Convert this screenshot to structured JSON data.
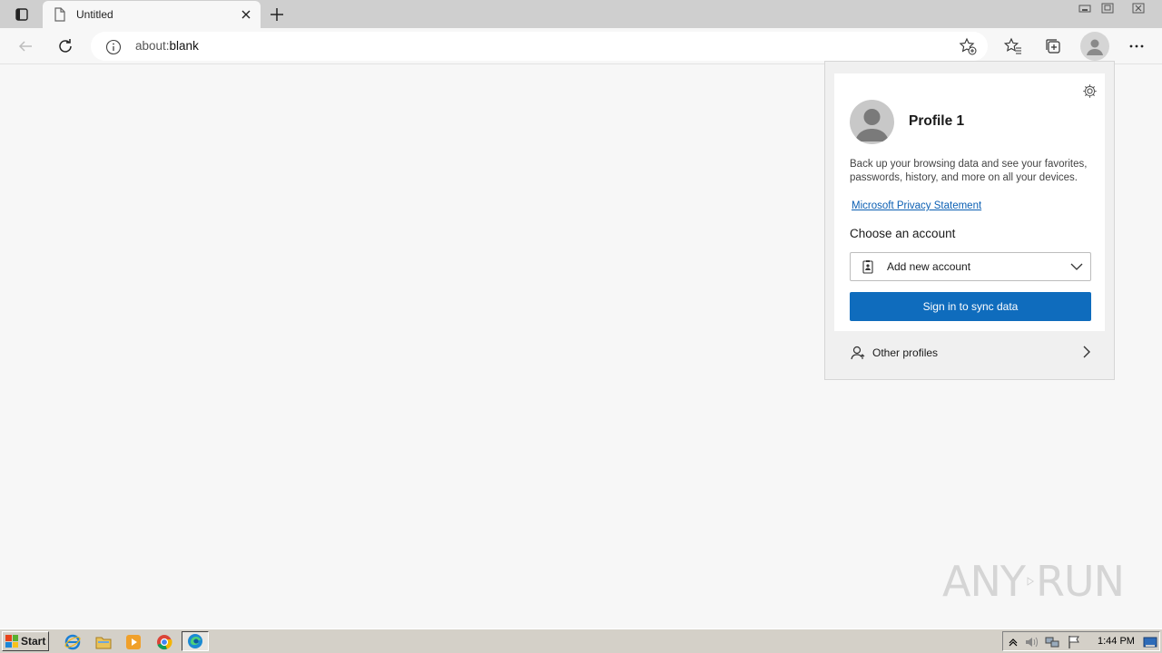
{
  "browser": {
    "tab": {
      "title": "Untitled",
      "icons": [
        "page-icon",
        "close-icon"
      ]
    },
    "address": {
      "prefix": "about:",
      "host": "blank"
    },
    "toolbar_icons": [
      "back-arrow-icon",
      "refresh-icon",
      "info-icon",
      "add-favorite-icon",
      "favorites-icon",
      "collections-icon",
      "profile-icon",
      "more-icon"
    ]
  },
  "profile_flyout": {
    "name": "Profile 1",
    "description": "Back up your browsing data and see your favorites, passwords, history, and more on all your devices.",
    "privacy_link": "Microsoft Privacy Statement",
    "choose_account_label": "Choose an account",
    "account_select_value": "Add new account",
    "sync_button": "Sign in to sync data",
    "other_profiles": "Other profiles"
  },
  "watermark": {
    "left": "ANY",
    "right": "RUN"
  },
  "taskbar": {
    "start_label": "Start",
    "clock": "1:44 PM",
    "quick_launch": [
      "internet-explorer-icon",
      "folder-icon",
      "media-player-icon",
      "chrome-icon",
      "edge-icon"
    ]
  },
  "colors": {
    "accent": "#0f6cbd",
    "link": "#0b5fb3",
    "taskbar": "#d4d0c8"
  }
}
